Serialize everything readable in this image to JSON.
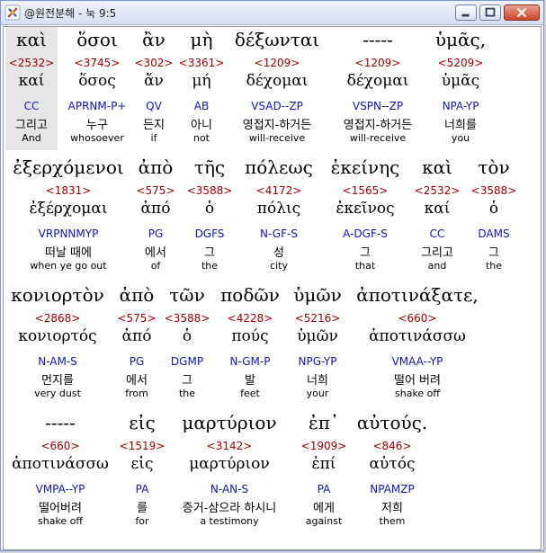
{
  "window": {
    "title": "@원전분해 - 눅 9:5"
  },
  "colors": {
    "strong": "#a00000",
    "parse": "#1414b4",
    "text": "#000000"
  },
  "icons": {
    "app": "cross-quill-icon",
    "minimize": "minimize-icon",
    "maximize": "maximize-icon",
    "close": "close-icon"
  },
  "rows": [
    {
      "words": [
        {
          "greek": "καὶ",
          "strong": "<2532>",
          "lemma": "καί",
          "parse": "CC",
          "korean": "그리고",
          "english": "And"
        },
        {
          "greek": "ὅσοι",
          "strong": "<3745>",
          "lemma": "ὅσος",
          "parse": "APRNM-P+",
          "korean": "누구",
          "english": "whosoever"
        },
        {
          "greek": "ἂν",
          "strong": "<302>",
          "lemma": "ἄν",
          "parse": "QV",
          "korean": "든지",
          "english": "if"
        },
        {
          "greek": "μὴ",
          "strong": "<3361>",
          "lemma": "μή",
          "parse": "AB",
          "korean": "아니",
          "english": "not"
        },
        {
          "greek": "δέξωνται",
          "strong": "<1209>",
          "lemma": "δέχομαι",
          "parse": "VSAD--ZP",
          "korean": "영접지-하거든",
          "english": "will-receive"
        },
        {
          "greek": "-----",
          "strong": "<1209>",
          "lemma": "δέχομαι",
          "parse": "VSPN--ZP",
          "korean": "영접지-하거든",
          "english": "will-receive"
        },
        {
          "greek": "ὑμᾶς,",
          "strong": "<5209>",
          "lemma": "ὑμᾶς",
          "parse": "NPA-YP",
          "korean": "너희를",
          "english": "you"
        }
      ]
    },
    {
      "words": [
        {
          "greek": "ἐξερχόμενοι",
          "strong": "<1831>",
          "lemma": "ἐξέρχομαι",
          "parse": "VRPNNMYP",
          "korean": "떠날 때에",
          "english": "when ye go out"
        },
        {
          "greek": "ἀπὸ",
          "strong": "<575>",
          "lemma": "ἀπό",
          "parse": "PG",
          "korean": "에서",
          "english": "of"
        },
        {
          "greek": "τῆς",
          "strong": "<3588>",
          "lemma": "ὁ",
          "parse": "DGFS",
          "korean": "그",
          "english": "the"
        },
        {
          "greek": "πόλεως",
          "strong": "<4172>",
          "lemma": "πόλις",
          "parse": "N-GF-S",
          "korean": "성",
          "english": "city"
        },
        {
          "greek": "ἐκείνης",
          "strong": "<1565>",
          "lemma": "ἐκεῖνος",
          "parse": "A-DGF-S",
          "korean": "그",
          "english": "that"
        },
        {
          "greek": "καὶ",
          "strong": "<2532>",
          "lemma": "καί",
          "parse": "CC",
          "korean": "그리고",
          "english": "and"
        },
        {
          "greek": "τὸν",
          "strong": "<3588>",
          "lemma": "ὁ",
          "parse": "DAMS",
          "korean": "그",
          "english": "the"
        }
      ]
    },
    {
      "words": [
        {
          "greek": "κονιορτὸν",
          "strong": "<2868>",
          "lemma": "κονιορτός",
          "parse": "N-AM-S",
          "korean": "먼지를",
          "english": "very dust"
        },
        {
          "greek": "ἀπὸ",
          "strong": "<575>",
          "lemma": "ἀπό",
          "parse": "PG",
          "korean": "에서",
          "english": "from"
        },
        {
          "greek": "τῶν",
          "strong": "<3588>",
          "lemma": "ὁ",
          "parse": "DGMP",
          "korean": "그",
          "english": "the"
        },
        {
          "greek": "ποδῶν",
          "strong": "<4228>",
          "lemma": "πούς",
          "parse": "N-GM-P",
          "korean": "발",
          "english": "feet"
        },
        {
          "greek": "ὑμῶν",
          "strong": "<5216>",
          "lemma": "ὑμῶν",
          "parse": "NPG-YP",
          "korean": "너희",
          "english": "your"
        },
        {
          "greek": "ἀποτινάξατε,",
          "strong": "<660>",
          "lemma": "ἀποτινάσσω",
          "parse": "VMAA--YP",
          "korean": "떨어 버려",
          "english": "shake off"
        }
      ]
    },
    {
      "words": [
        {
          "greek": "-----",
          "strong": "<660>",
          "lemma": "ἀποτινάσσω",
          "parse": "VMPA--YP",
          "korean": "떨어버려",
          "english": "shake off"
        },
        {
          "greek": "εἰς",
          "strong": "<1519>",
          "lemma": "εἰς",
          "parse": "PA",
          "korean": "를",
          "english": "for"
        },
        {
          "greek": "μαρτύριον",
          "strong": "<3142>",
          "lemma": "μαρτύριον",
          "parse": "N-AN-S",
          "korean": "증거-삼으라 하시니",
          "english": "a testimony"
        },
        {
          "greek": "ἐπ᾽",
          "strong": "<1909>",
          "lemma": "ἐπί",
          "parse": "PA",
          "korean": "에게",
          "english": "against"
        },
        {
          "greek": "αὐτούς.",
          "strong": "<846>",
          "lemma": "αὐτός",
          "parse": "NPAMZP",
          "korean": "저희",
          "english": "them"
        }
      ]
    }
  ]
}
